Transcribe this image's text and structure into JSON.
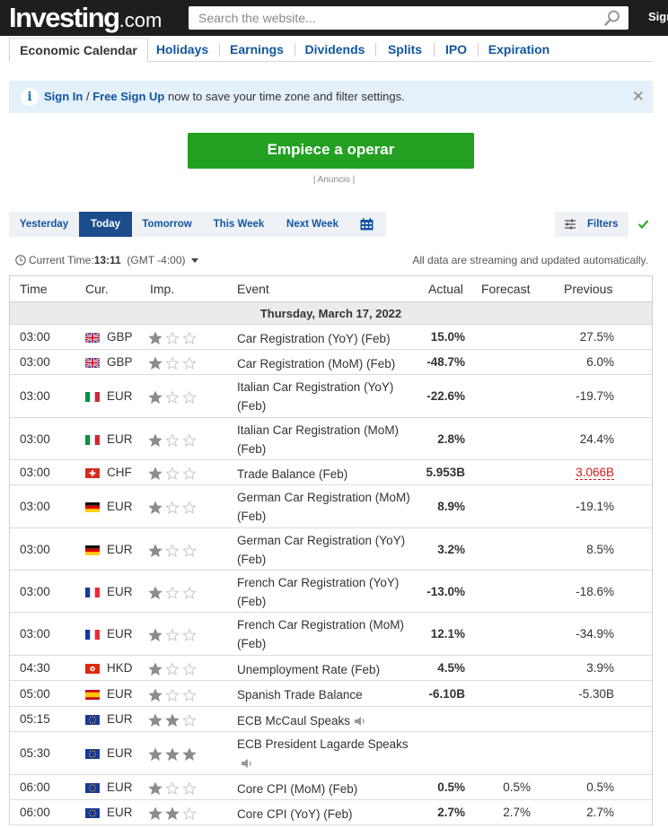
{
  "header": {
    "logo_main": "Investing",
    "logo_suffix": ".com",
    "search_placeholder": "Search the website...",
    "signin": "Sign In"
  },
  "tabs": [
    "Economic Calendar",
    "Holidays",
    "Earnings",
    "Dividends",
    "Splits",
    "IPO",
    "Expiration"
  ],
  "banner": {
    "signin": "Sign In",
    "sep": " / ",
    "signup": "Free Sign Up",
    "text": " now to save your time zone and filter settings."
  },
  "ad": {
    "button": "Empiece a operar",
    "label": "| Anuncio |"
  },
  "datenav": [
    "Yesterday",
    "Today",
    "Tomorrow",
    "This Week",
    "Next Week"
  ],
  "filters_label": "Filters",
  "time": {
    "label": "Current Time:",
    "value": "13:11",
    "zone": "(GMT -4:00)"
  },
  "streaming": "All data are streaming and updated automatically.",
  "table": {
    "headers": {
      "time": "Time",
      "cur": "Cur.",
      "imp": "Imp.",
      "event": "Event",
      "actual": "Actual",
      "forecast": "Forecast",
      "previous": "Previous"
    },
    "day": "Thursday, March 17, 2022",
    "colors": {
      "star_on": "#8c8c8c",
      "star_off": "#c8c8c8",
      "negative_previous": "#d51a1a"
    },
    "rows": [
      {
        "time": "03:00",
        "flag": "gb",
        "cur": "GBP",
        "imp": 1,
        "event": "Car Registration (YoY) (Feb)",
        "actual": "15.0%",
        "forecast": "",
        "previous": "27.5%",
        "h": 28
      },
      {
        "time": "03:00",
        "flag": "gb",
        "cur": "GBP",
        "imp": 1,
        "event": "Car Registration (MoM) (Feb)",
        "actual": "-48.7%",
        "forecast": "",
        "previous": "6.0%",
        "h": 28
      },
      {
        "time": "03:00",
        "flag": "it",
        "cur": "EUR",
        "imp": 1,
        "event": "Italian Car Registration (YoY) (Feb)",
        "actual": "-22.6%",
        "forecast": "",
        "previous": "-19.7%",
        "h": 48
      },
      {
        "time": "03:00",
        "flag": "it",
        "cur": "EUR",
        "imp": 1,
        "event": "Italian Car Registration (MoM) (Feb)",
        "actual": "2.8%",
        "forecast": "",
        "previous": "24.4%",
        "h": 47
      },
      {
        "time": "03:00",
        "flag": "ch",
        "cur": "CHF",
        "imp": 1,
        "event": "Trade Balance (Feb)",
        "actual": "5.953B",
        "forecast": "",
        "previous": "3.066B",
        "prev_red": true,
        "h": 28
      },
      {
        "time": "03:00",
        "flag": "de",
        "cur": "EUR",
        "imp": 1,
        "event": "German Car Registration (MoM) (Feb)",
        "actual": "8.9%",
        "forecast": "",
        "previous": "-19.1%",
        "h": 48
      },
      {
        "time": "03:00",
        "flag": "de",
        "cur": "EUR",
        "imp": 1,
        "event": "German Car Registration (YoY) (Feb)",
        "actual": "3.2%",
        "forecast": "",
        "previous": "8.5%",
        "h": 47
      },
      {
        "time": "03:00",
        "flag": "fr",
        "cur": "EUR",
        "imp": 1,
        "event": "French Car Registration (YoY) (Feb)",
        "actual": "-13.0%",
        "forecast": "",
        "previous": "-18.6%",
        "h": 47
      },
      {
        "time": "03:00",
        "flag": "fr",
        "cur": "EUR",
        "imp": 1,
        "event": "French Car Registration (MoM) (Feb)",
        "actual": "12.1%",
        "forecast": "",
        "previous": "-34.9%",
        "h": 48
      },
      {
        "time": "04:30",
        "flag": "hk",
        "cur": "HKD",
        "imp": 1,
        "event": "Unemployment Rate (Feb)",
        "actual": "4.5%",
        "forecast": "",
        "previous": "3.9%",
        "h": 28
      },
      {
        "time": "05:00",
        "flag": "es",
        "cur": "EUR",
        "imp": 1,
        "event": "Spanish Trade Balance",
        "actual": "-6.10B",
        "forecast": "",
        "previous": "-5.30B",
        "h": 29
      },
      {
        "time": "05:15",
        "flag": "eu",
        "cur": "EUR",
        "imp": 2,
        "event": "ECB McCaul Speaks",
        "speaker": true,
        "actual": "",
        "forecast": "",
        "previous": "",
        "h": 28
      },
      {
        "time": "05:30",
        "flag": "eu",
        "cur": "EUR",
        "imp": 3,
        "event": "ECB President Lagarde Speaks",
        "speaker": true,
        "actual": "",
        "forecast": "",
        "previous": "",
        "h": 48
      },
      {
        "time": "06:00",
        "flag": "eu",
        "cur": "EUR",
        "imp": 1,
        "event": "Core CPI (MoM) (Feb)",
        "actual": "0.5%",
        "forecast": "0.5%",
        "previous": "0.5%",
        "h": 28
      },
      {
        "time": "06:00",
        "flag": "eu",
        "cur": "EUR",
        "imp": 2,
        "event": "Core CPI (YoY) (Feb)",
        "actual": "2.7%",
        "forecast": "2.7%",
        "previous": "2.7%",
        "h": 28
      }
    ]
  }
}
